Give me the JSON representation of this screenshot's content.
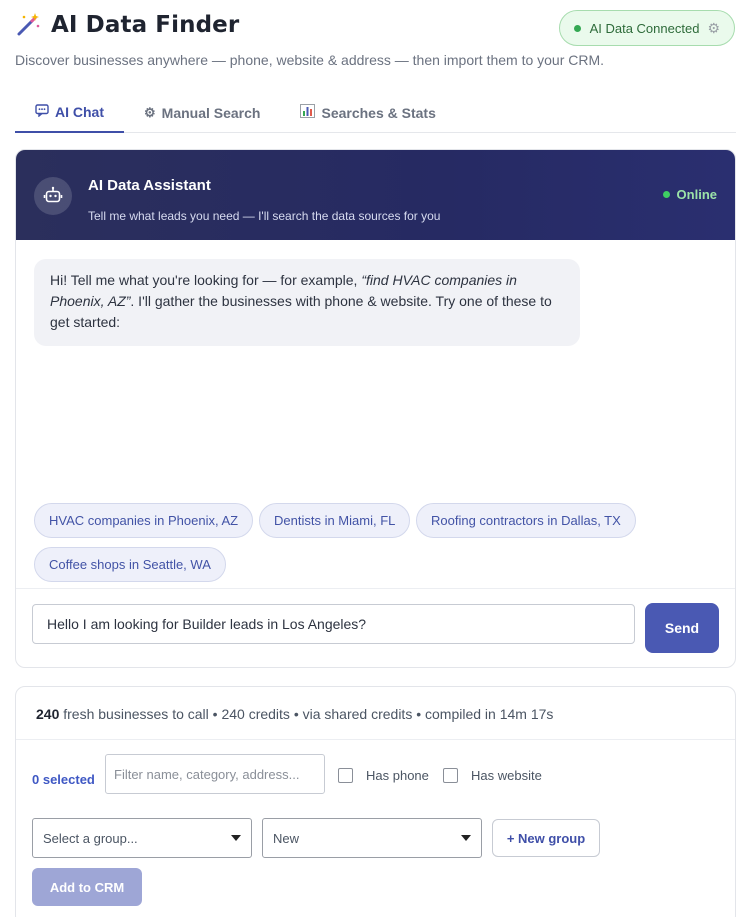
{
  "app": {
    "title": "AI Data Finder",
    "subtitle": "Discover businesses anywhere — phone, website & address — then import them to your CRM.",
    "icon": "magic-wand-icon"
  },
  "connection": {
    "label": "AI Data Connected",
    "status_color": "#34a853",
    "gear_glyph": "⚙"
  },
  "tabs": [
    {
      "label": "AI Chat",
      "glyph": "💬",
      "active": true
    },
    {
      "label": "Manual Search",
      "glyph": "⚙",
      "active": false
    },
    {
      "label": "Searches & Stats",
      "glyph": "📊",
      "active": false
    }
  ],
  "assistant": {
    "title": "AI Data Assistant",
    "subtitle": "Tell me what leads you need — I'll search the data sources for you",
    "status": "Online",
    "icon": "robot-icon"
  },
  "message": {
    "lead": "Hi! Tell me what you're looking for — for example, ",
    "example": "“find HVAC companies in Phoenix, AZ”",
    "tail": ". I'll gather the businesses with phone & website. Try one of these to get started:"
  },
  "suggestions": [
    "HVAC companies in Phoenix, AZ",
    "Dentists in Miami, FL",
    "Roofing contractors in Dallas, TX",
    "Coffee shops in Seattle, WA"
  ],
  "chat_input": {
    "value": "Hello I am looking for Builder leads in Los Angeles?"
  },
  "send_label": "Send",
  "results": {
    "count": "240",
    "summary_rest": " fresh businesses to call • 240 credits • via shared credits • compiled in 14m 17s",
    "selected_label": "0 selected",
    "filter_placeholder": "Filter name, category, address...",
    "has_phone_label": "Has phone",
    "has_website_label": "Has website",
    "group_select": "Select a group...",
    "status_select": "New",
    "new_group_label": "+ New group",
    "add_crm_label": "Add to CRM"
  },
  "colors": {
    "accent": "#4a59b3",
    "header_bg": "#262a63",
    "connected_bg": "#eafaec"
  }
}
